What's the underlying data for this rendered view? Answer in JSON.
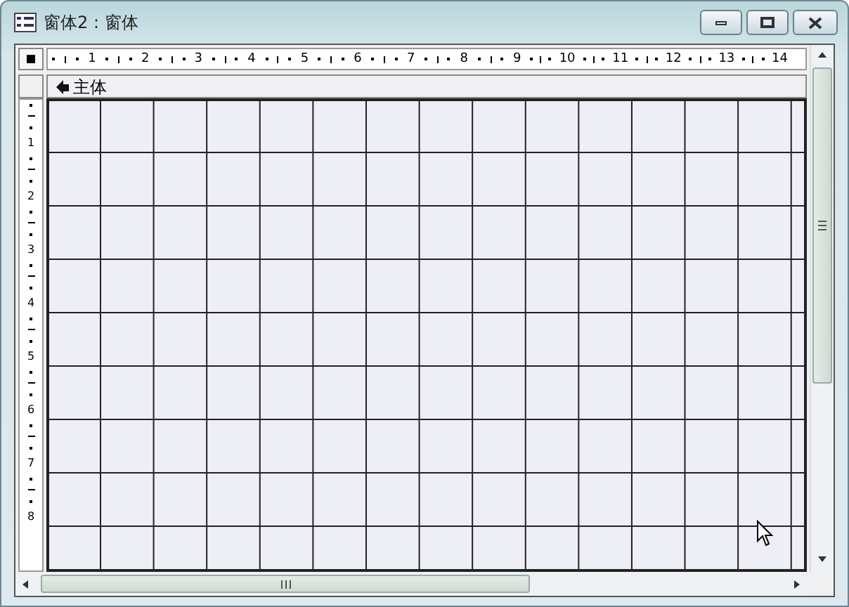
{
  "window": {
    "title": "窗体2 : 窗体"
  },
  "ruler_horizontal": [
    "1",
    "2",
    "3",
    "4",
    "5",
    "6",
    "7",
    "8",
    "9",
    "10",
    "11",
    "12",
    "13",
    "14"
  ],
  "ruler_vertical": [
    "1",
    "2",
    "3",
    "4",
    "5",
    "6",
    "7",
    "8"
  ],
  "section": {
    "label": "主体"
  }
}
